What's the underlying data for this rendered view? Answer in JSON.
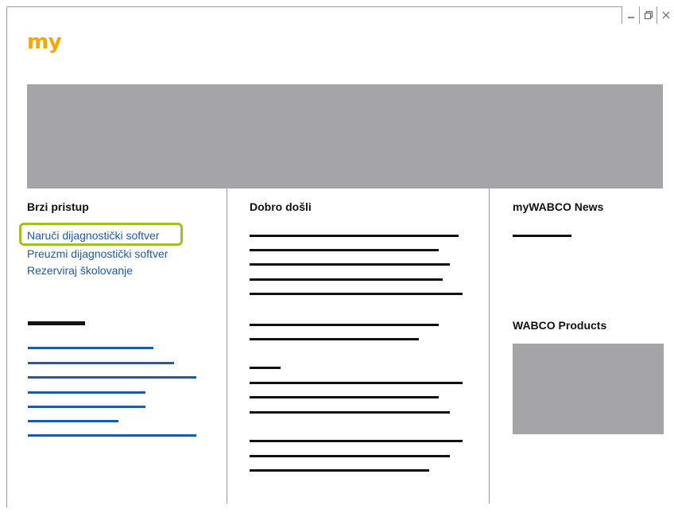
{
  "window": {
    "minimize_label": "_",
    "restore_label": "restore",
    "close_label": "×"
  },
  "header": {
    "logo_text": "my",
    "logo_color": "#f7a600"
  },
  "columns": {
    "quick_access": {
      "title": "Brzi pristup",
      "links": [
        "Naruči dijagnostički softver",
        "Preuzmi dijagnostički softver",
        "Rezerviraj školovanje"
      ],
      "highlighted_index": 0
    },
    "welcome": {
      "title": "Dobro došli"
    },
    "news": {
      "title": "myWABCO News"
    },
    "products": {
      "title": "WABCO Products"
    }
  },
  "colors": {
    "link": "#1f5aa6",
    "highlight": "#9bc31b",
    "placeholder_gray": "#a5a5a8"
  }
}
